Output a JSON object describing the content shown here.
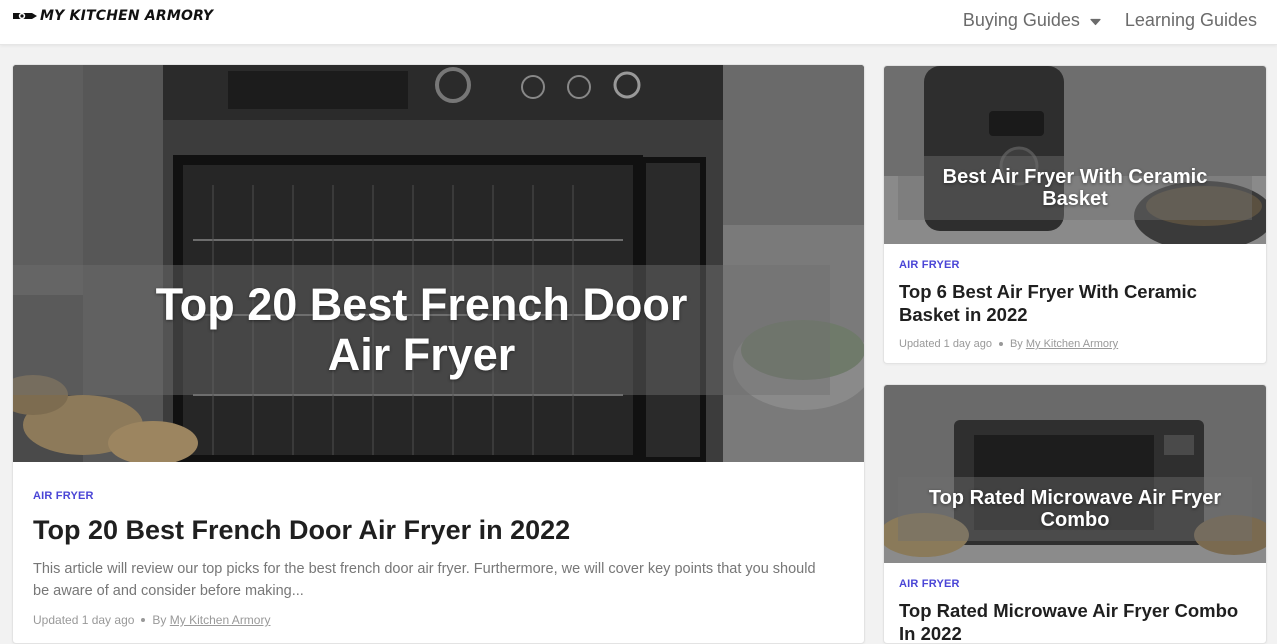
{
  "header": {
    "logo_text": "MY KITCHEN ARMORY",
    "nav": [
      {
        "label": "Buying Guides",
        "has_dropdown": true
      },
      {
        "label": "Learning Guides",
        "has_dropdown": false
      }
    ]
  },
  "main_post": {
    "image_overlay_text": "Top 20 Best French Door Air Fryer",
    "category": "AIR FRYER",
    "title": "Top 20 Best French Door Air Fryer in 2022",
    "excerpt": "This article will review our top picks for the best french door air fryer. Furthermore, we will cover key points that you should be aware of and consider before making...",
    "updated": "Updated 1 day ago",
    "by": "By",
    "author": "My Kitchen Armory"
  },
  "side_posts": [
    {
      "image_overlay_text": "Best Air Fryer With Ceramic Basket",
      "category": "AIR FRYER",
      "title": "Top 6 Best Air Fryer With Ceramic Basket in 2022",
      "updated": "Updated 1 day ago",
      "by": "By",
      "author": "My Kitchen Armory"
    },
    {
      "image_overlay_text": "Top Rated Microwave Air Fryer Combo",
      "category": "AIR FRYER",
      "title": "Top Rated Microwave Air Fryer Combo In 2022"
    }
  ],
  "colors": {
    "category": "#4a45d6",
    "nav_text": "#6b6b6b",
    "title": "#1f1f1f"
  },
  "icons": [
    "logo-knife-icon",
    "chevron-down-icon"
  ]
}
